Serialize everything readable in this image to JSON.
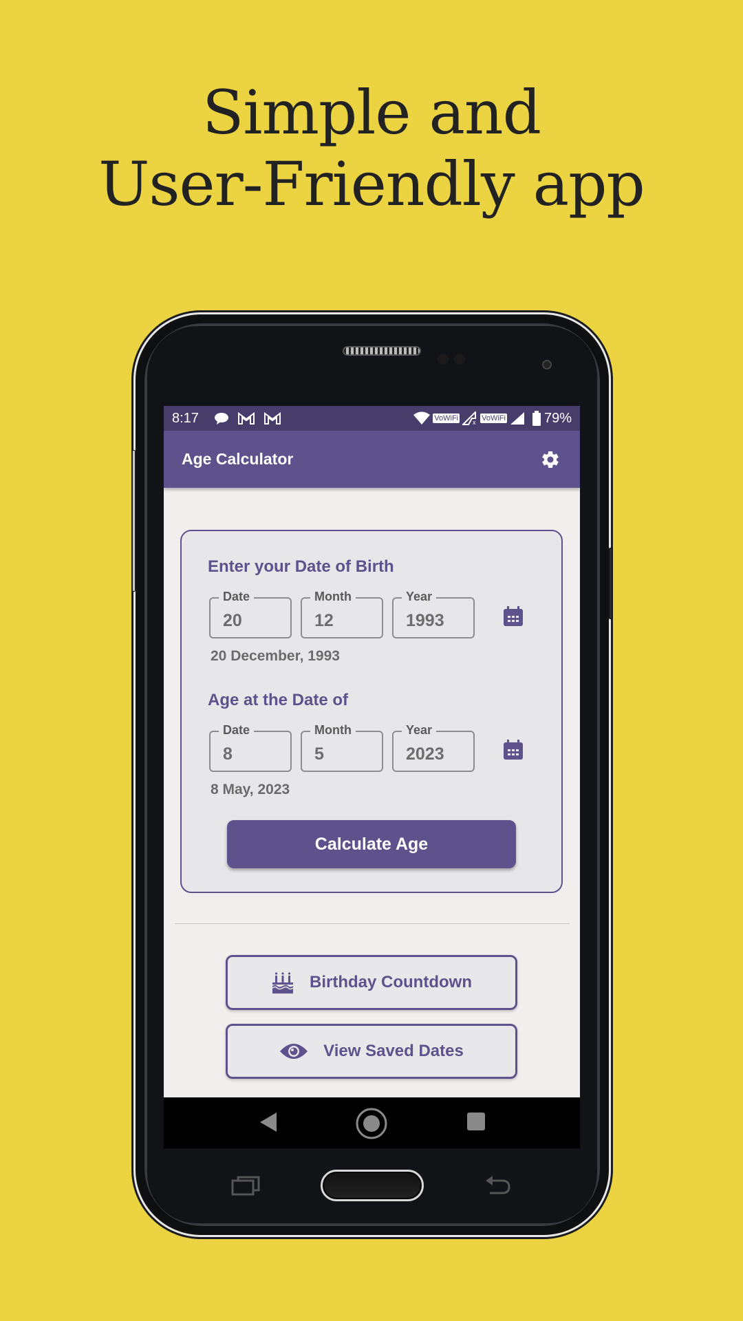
{
  "headline": {
    "line1": "Simple and",
    "line2": "User-Friendly app"
  },
  "status_bar": {
    "time": "8:17",
    "left_icons": [
      "chat-bubble-icon",
      "gmail-icon",
      "gmail-icon"
    ],
    "right_icons": [
      "wifi-icon",
      "vowifi-badge",
      "signal-no-data-icon",
      "vowifi-badge",
      "signal-icon",
      "battery-icon"
    ],
    "vowifi_label": "VoWiFi",
    "battery": "79%"
  },
  "app_bar": {
    "title": "Age Calculator",
    "settings_icon": "gear-icon"
  },
  "birth_section": {
    "title": "Enter your Date of Birth",
    "fields": [
      {
        "label": "Date",
        "value": "20"
      },
      {
        "label": "Month",
        "value": "12"
      },
      {
        "label": "Year",
        "value": "1993"
      }
    ],
    "summary": "20 December, 1993",
    "calendar_icon": "calendar-icon"
  },
  "age_at_section": {
    "title": "Age at the Date of",
    "fields": [
      {
        "label": "Date",
        "value": "8"
      },
      {
        "label": "Month",
        "value": "5"
      },
      {
        "label": "Year",
        "value": "2023"
      }
    ],
    "summary": "8 May, 2023",
    "calendar_icon": "calendar-icon"
  },
  "calculate_button": "Calculate Age",
  "actions": [
    {
      "label": "Birthday Countdown",
      "icon": "birthday-cake-icon"
    },
    {
      "label": "View Saved Dates",
      "icon": "eye-icon"
    }
  ],
  "nav_bar": {
    "items": [
      "back-icon",
      "home-icon",
      "recents-icon"
    ]
  },
  "colors": {
    "background": "#ebd342",
    "primary": "#5d528c",
    "status_bar": "#463d6b",
    "screen_bg": "#f1efed",
    "card_bg": "#e7e6e9"
  }
}
